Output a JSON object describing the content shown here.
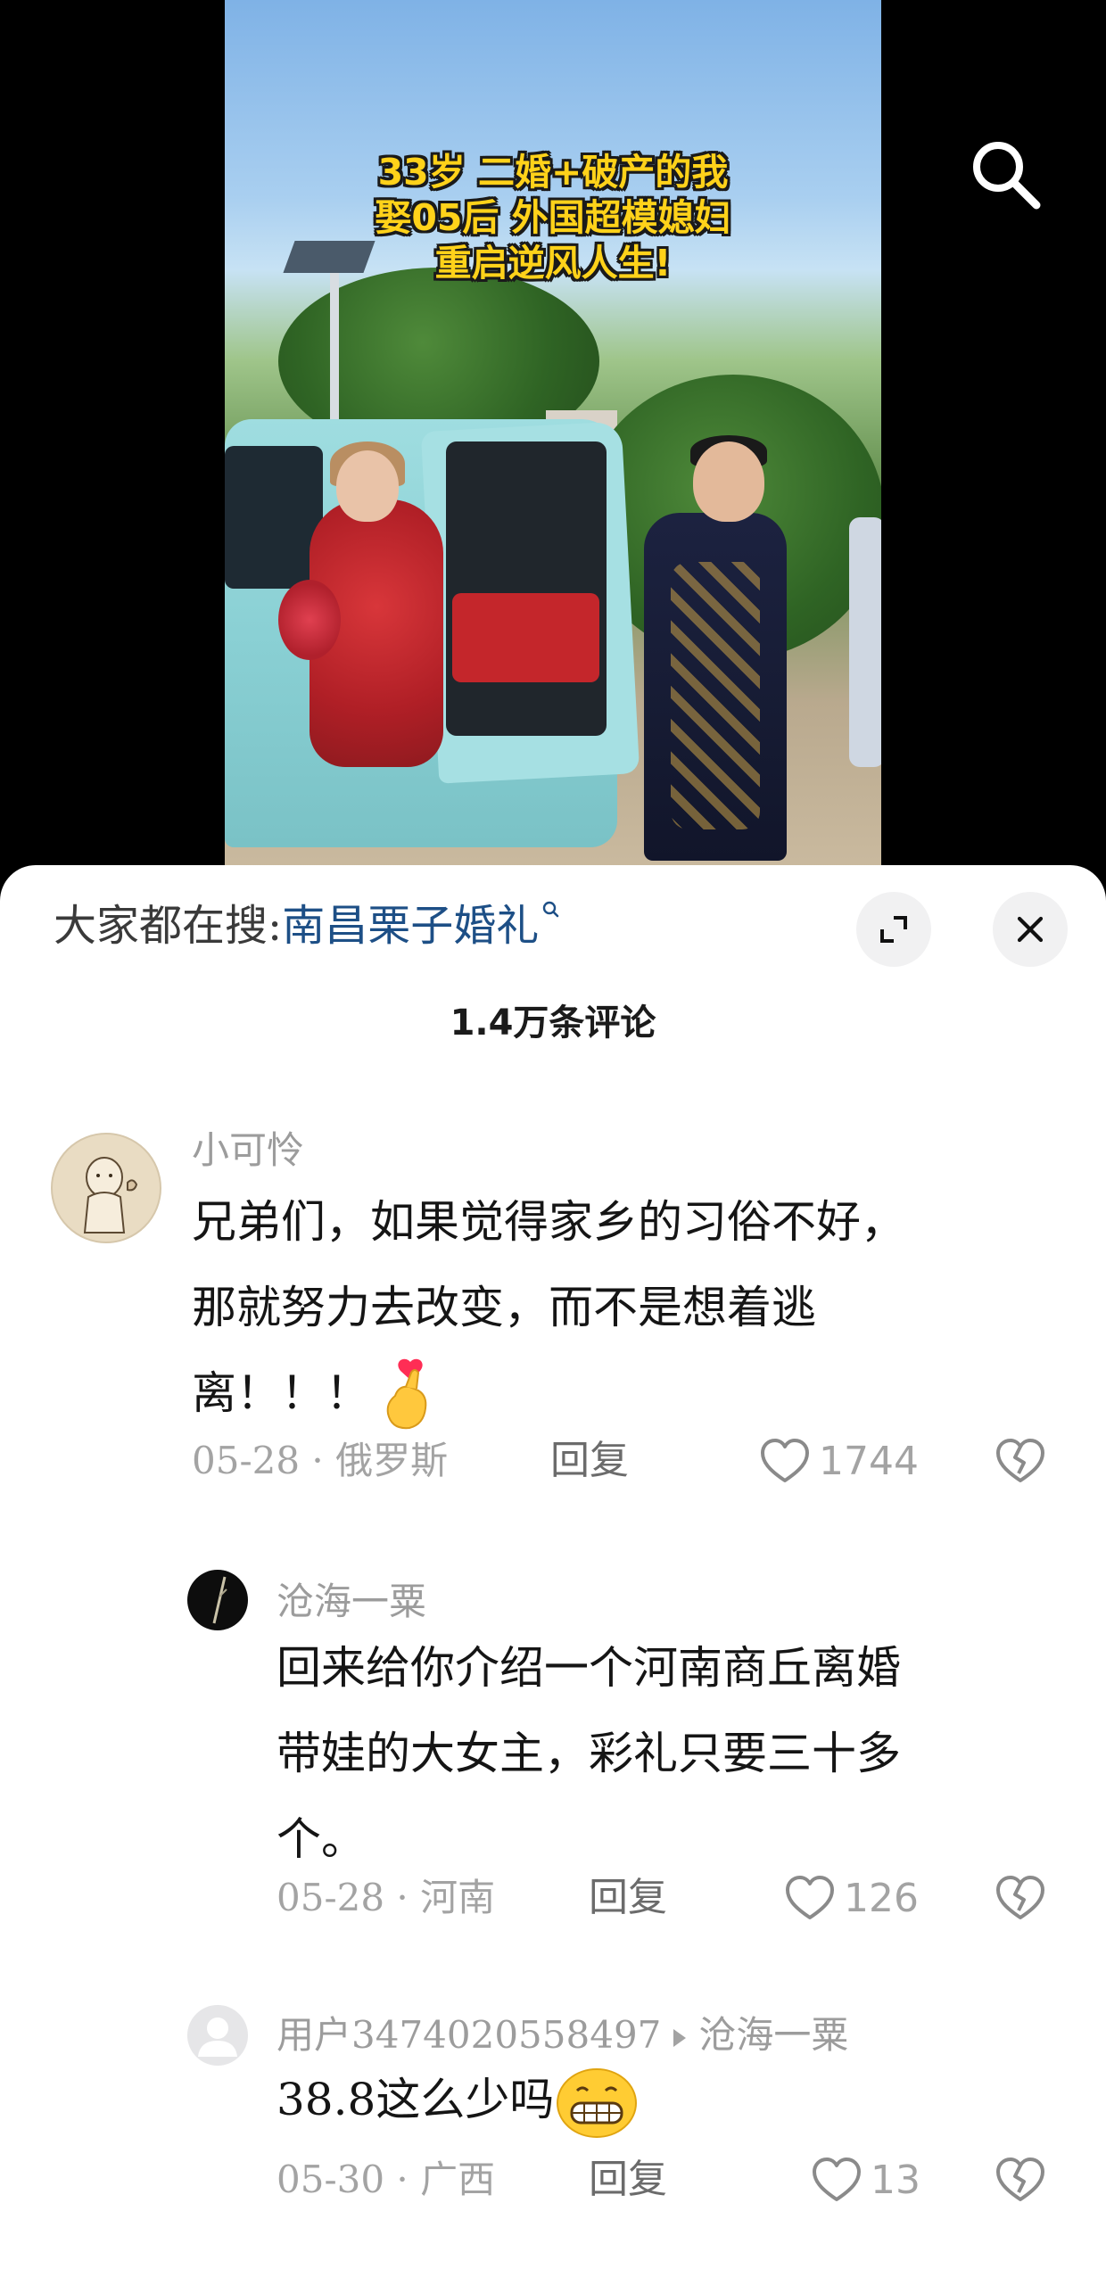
{
  "video": {
    "overlay_title_lines": [
      "33岁 二婚+破产的我",
      "娶05后 外国超模媳妇",
      "重启逆风人生!"
    ],
    "search_icon": "search-icon"
  },
  "sheet": {
    "search_hint_label": "大家都在搜:",
    "search_hint_keyword": "南昌栗子婚礼",
    "comment_count": "1.4万条评论"
  },
  "comments": [
    {
      "name": "小可怜",
      "text_lines": [
        "兄弟们，如果觉得家乡的习俗不好，",
        "那就努力去改变，而不是想着逃",
        "离！！！"
      ],
      "date": "05-28",
      "location": "俄罗斯",
      "reply_label": "回复",
      "likes": "1744"
    },
    {
      "name": "沧海一粟",
      "text_lines": [
        "回来给你介绍一个河南商丘离婚",
        "带娃的大女主，彩礼只要三十多",
        "个。"
      ],
      "date": "05-28",
      "location": "河南",
      "reply_label": "回复",
      "likes": "126"
    },
    {
      "name": "用户3474020558497",
      "reply_to": "沧海一粟",
      "text": "38.8这么少吗",
      "date": "05-30",
      "location": "广西",
      "reply_label": "回复",
      "likes": "13"
    }
  ],
  "colors": {
    "keyword_blue": "#1d4f86",
    "meta_gray": "#a3a3a3",
    "title_yellow": "#ffd21a"
  }
}
